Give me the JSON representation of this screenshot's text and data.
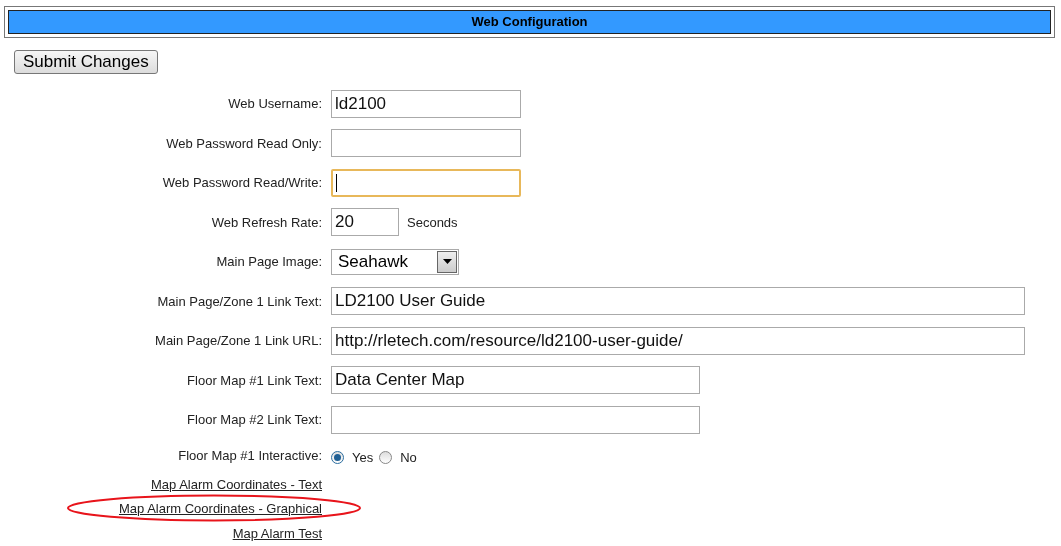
{
  "header": {
    "title": "Web Configuration"
  },
  "submit_button": {
    "label": "Submit Changes"
  },
  "fields": [
    {
      "kind": "text",
      "label": "Web Username:",
      "value": "ld2100",
      "focused": false
    },
    {
      "kind": "text",
      "label": "Web Password Read Only:",
      "focused": false
    },
    {
      "kind": "text",
      "label": "Web Password Read/Write:",
      "focused": true
    },
    {
      "kind": "number",
      "label": "Web Refresh Rate:",
      "value": "20",
      "suffix": "Seconds",
      "focused": false
    },
    {
      "kind": "select",
      "label": "Main Page Image:",
      "value": "Seahawk"
    },
    {
      "kind": "wide",
      "label": "Main Page/Zone 1 Link Text:",
      "value": "LD2100 User Guide",
      "focused": false
    },
    {
      "kind": "wide",
      "label": "Main Page/Zone 1 Link URL:",
      "value": "http://rletech.com/resource/ld2100-user-guide/",
      "focused": false
    },
    {
      "kind": "medium",
      "label": "Floor Map #1 Link Text:",
      "value": "Data Center Map",
      "focused": false
    },
    {
      "kind": "medium",
      "label": "Floor Map #2 Link Text:",
      "focused": false
    },
    {
      "kind": "radio",
      "label": "Floor Map #1 Interactive:",
      "options": [
        {
          "label": "Yes",
          "selected": true
        },
        {
          "label": "No",
          "selected": false
        }
      ]
    }
  ],
  "links": [
    {
      "label": "Map Alarm Coordinates - Text",
      "circled": false
    },
    {
      "label": "Map Alarm Coordinates - Graphical",
      "circled": true
    },
    {
      "label": "Map Alarm Test",
      "circled": false
    }
  ]
}
